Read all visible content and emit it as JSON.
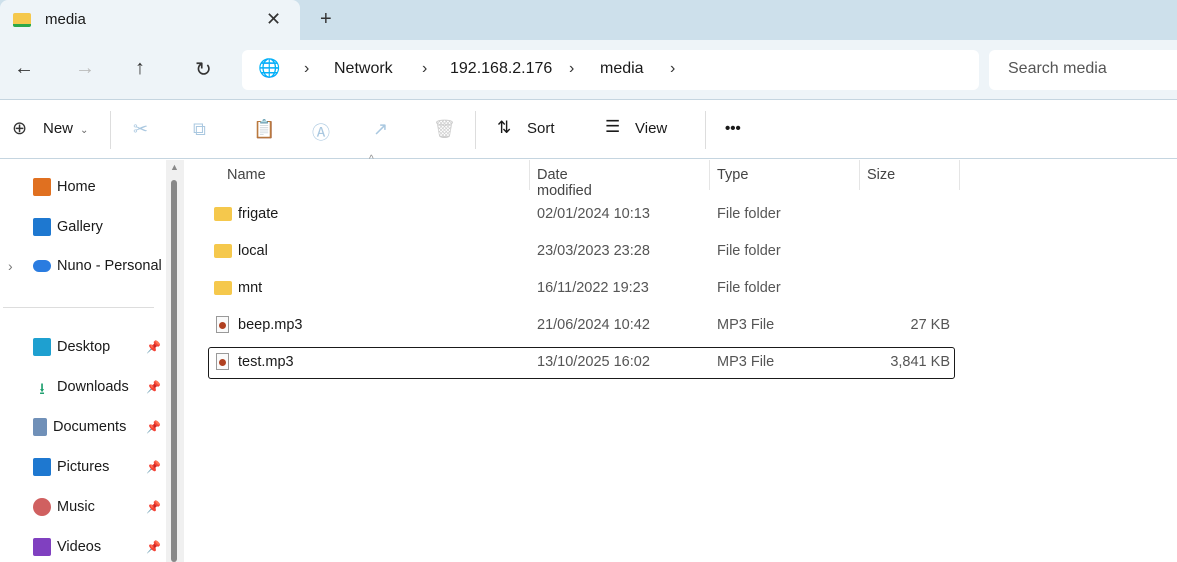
{
  "tab": {
    "title": "media",
    "close": "✕",
    "new": "+"
  },
  "nav": {
    "back": "←",
    "forward": "→",
    "up": "↑",
    "refresh": "↻"
  },
  "breadcrumb": [
    "Network",
    "192.168.2.176",
    "media"
  ],
  "search": {
    "placeholder": "Search media"
  },
  "toolbar": {
    "new": "New",
    "sort": "Sort",
    "view": "View",
    "more": "•••"
  },
  "sidebar": {
    "items": [
      {
        "label": "Home",
        "color": "#e07020"
      },
      {
        "label": "Gallery",
        "color": "#1e78d0"
      },
      {
        "label": "Nuno - Personal",
        "color": "#2a7ce0"
      },
      {
        "label": "Desktop",
        "color": "#1ea0d0"
      },
      {
        "label": "Downloads",
        "color": "#20a070"
      },
      {
        "label": "Documents",
        "color": "#7090b8"
      },
      {
        "label": "Pictures",
        "color": "#1e78d0"
      },
      {
        "label": "Music",
        "color": "#d06060"
      },
      {
        "label": "Videos",
        "color": "#8040c0"
      }
    ]
  },
  "columns": {
    "name": "Name",
    "date": "Date modified",
    "type": "Type",
    "size": "Size"
  },
  "files": [
    {
      "name": "frigate",
      "date": "02/01/2024 10:13",
      "type": "File folder",
      "size": ""
    },
    {
      "name": "local",
      "date": "23/03/2023 23:28",
      "type": "File folder",
      "size": ""
    },
    {
      "name": "mnt",
      "date": "16/11/2022 19:23",
      "type": "File folder",
      "size": ""
    },
    {
      "name": "beep.mp3",
      "date": "21/06/2024 10:42",
      "type": "MP3 File",
      "size": "27 KB"
    },
    {
      "name": "test.mp3",
      "date": "13/10/2025 16:02",
      "type": "MP3 File",
      "size": "3,841 KB"
    }
  ]
}
